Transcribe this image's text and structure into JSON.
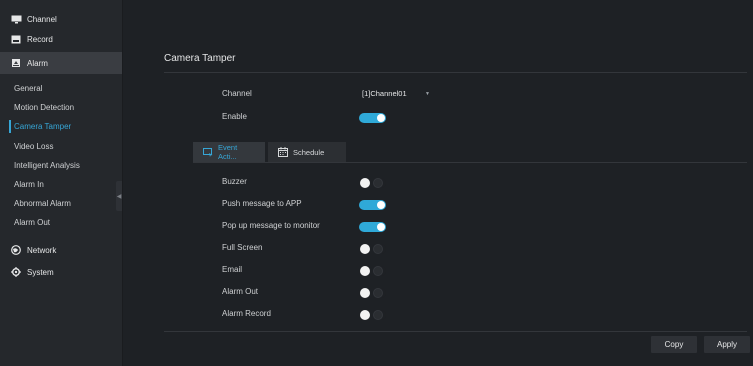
{
  "sidebar": {
    "top_items": [
      {
        "label": "Channel",
        "icon": "monitor-icon"
      },
      {
        "label": "Record",
        "icon": "record-icon"
      },
      {
        "label": "Alarm",
        "icon": "alarm-icon"
      }
    ],
    "alarm_sub_items": [
      "General",
      "Motion Detection",
      "Camera Tamper",
      "Video Loss",
      "Intelligent Analysis",
      "Alarm In",
      "Abnormal Alarm",
      "Alarm Out"
    ],
    "selected_sub_item": "Camera Tamper",
    "bottom_items": [
      {
        "label": "Network",
        "icon": "globe-icon"
      },
      {
        "label": "System",
        "icon": "gear-icon"
      }
    ]
  },
  "page": {
    "title": "Camera Tamper",
    "channel_label": "Channel",
    "channel_value": "[1]Channel01",
    "enable_label": "Enable",
    "enable_on": true
  },
  "tabs": [
    {
      "label": "Event Acti...",
      "icon": "event-action-icon",
      "active": true
    },
    {
      "label": "Schedule",
      "icon": "calendar-icon",
      "active": false
    }
  ],
  "actions": [
    {
      "label": "Buzzer",
      "on": false
    },
    {
      "label": "Push message to APP",
      "on": true
    },
    {
      "label": "Pop up message to monitor",
      "on": true
    },
    {
      "label": "Full Screen",
      "on": false
    },
    {
      "label": "Email",
      "on": false
    },
    {
      "label": "Alarm Out",
      "on": false
    },
    {
      "label": "Alarm Record",
      "on": false
    }
  ],
  "buttons": {
    "copy": "Copy",
    "apply": "Apply"
  },
  "colors": {
    "accent": "#36a6d6",
    "toggle_on": "#2fa9d8",
    "background": "#1e2125",
    "sidebar": "#25282c"
  }
}
